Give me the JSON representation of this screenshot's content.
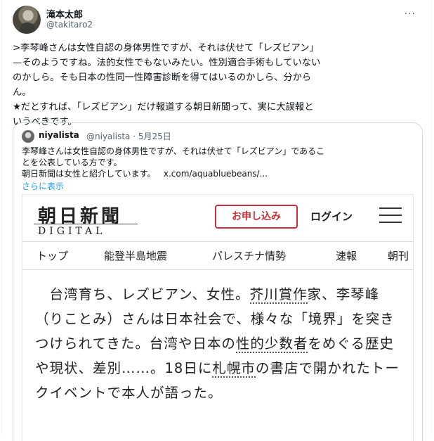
{
  "tweet": {
    "author_name": "滝本太郎",
    "author_handle": "@takitaro2",
    "more": "···",
    "text": ">李琴峰さんは女性自認の身体男性ですが、それは伏せて「レズビアン」\n—そのようですね。法的女性でもないみたい。性別適合手術もしていない\nのかしら。そも日本の性同一性障害診断を得てはいるのかしら、分から\nん。\n★だとすれば、「レズビアン」だけ報道する朝日新聞って、実に大誤報と\nいうべきです。"
  },
  "quote": {
    "author_name": "niyalista",
    "author_handle": "@niyalista",
    "date": "· 5月25日",
    "text": "李琴峰さんは女性自認の身体男性ですが、それは伏せて「レズビアン」であるこ\nとを公表している方です。\n朝日新聞は女性と紹介しています。   x.com/aquabluebeans/...",
    "show_more": "さらに表示"
  },
  "article": {
    "logo_main": "朝日新聞",
    "logo_sub": "DIGITAL",
    "subscribe": "お申し込み",
    "login": "ログイン",
    "nav": [
      "トップ",
      "能登半島地震",
      "パレスチナ情勢",
      "速報",
      "朝刊"
    ],
    "lead_1": "　台湾育ち、レズビアン、女性。",
    "lead_link_1": "芥川賞作",
    "lead_2": "家",
    "lead_3": "、李琴峰（りことみ）さんは日本社会で、様々な「境界」を突きつけられてきた。台湾や日本の",
    "lead_link_2": "性的少数者",
    "lead_4": "をめぐる歴史や現状、差別……。18日に",
    "lead_link_3": "札幌市",
    "lead_5": "の書店で開かれたトークイベントで本人が語った。"
  }
}
